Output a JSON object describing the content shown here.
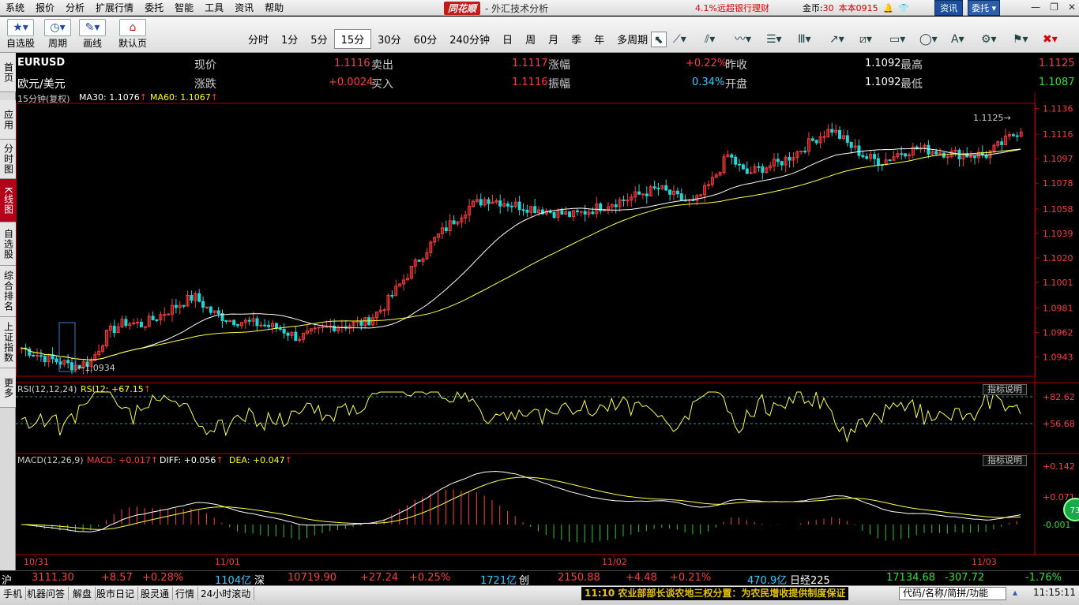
{
  "menu": [
    "系统",
    "报价",
    "分析",
    "扩展行情",
    "委托",
    "智能",
    "工具",
    "资讯",
    "帮助"
  ],
  "brand": {
    "logo": "同花顺",
    "title": "- 外汇技术分析"
  },
  "menu_right": {
    "ad": "4.1%远超银行理财",
    "gold_label": "金币:",
    "gold_value": "30",
    "version": "本本0915",
    "news_btn": "资讯",
    "trade_btn": "委托"
  },
  "toolbar": {
    "buttons": [
      {
        "label": "自选股",
        "icon": "star-icon"
      },
      {
        "label": "周期",
        "icon": "clock-icon"
      },
      {
        "label": "画线",
        "icon": "pencil-icon"
      },
      {
        "label": "默认页",
        "icon": "home-icon"
      }
    ],
    "periods": [
      "分时",
      "1分",
      "5分",
      "15分",
      "30分",
      "60分",
      "240分钟",
      "日",
      "周",
      "月",
      "季",
      "年",
      "多周期"
    ],
    "selected_period": "15分"
  },
  "vtabs": [
    {
      "label": "首页"
    },
    {
      "label": "应用"
    },
    {
      "label": "分时图"
    },
    {
      "label": "K线图",
      "selected": true
    },
    {
      "label": "自选股"
    },
    {
      "label": "综合排名"
    },
    {
      "label": "上证指数"
    },
    {
      "label": "更多"
    }
  ],
  "quote": {
    "symbol": "EURUSD",
    "name": "欧元/美元",
    "labels": {
      "price": "现价",
      "change": "涨跌",
      "sell": "卖出",
      "buy": "买入",
      "pct": "涨幅",
      "amp": "振幅",
      "prev": "昨收",
      "open": "开盘",
      "high": "最高",
      "low": "最低"
    },
    "price": "1.1116",
    "change": "+0.0024",
    "sell": "1.1117",
    "buy": "1.1116",
    "pct": "+0.22%",
    "amp": "0.34%",
    "prev": "1.1092",
    "open": "1.1092",
    "high": "1.1125",
    "low": "1.1087"
  },
  "indicators": {
    "main": {
      "label": "15分钟(复权)",
      "ma30": "MA30: 1.1076",
      "ma60": "MA60: 1.1067"
    },
    "rsi": {
      "label": "RSI(12,12,24)",
      "value": "RSI12: +67.15",
      "button": "指标说明"
    },
    "macd": {
      "label": "MACD(12,26,9)",
      "macd": "MACD: +0.017",
      "diff": "DIFF: +0.056",
      "dea": "DEA: +0.047",
      "button": "指标说明"
    }
  },
  "chart_data": {
    "type": "candlestick",
    "price_axis": {
      "ticks": [
        "1.1136",
        "1.1116",
        "1.1097",
        "1.1078",
        "1.1058",
        "1.1039",
        "1.1020",
        "1.1001",
        "1.0981",
        "1.0962",
        "1.0943"
      ],
      "min": 1.0928,
      "max": 1.114
    },
    "rsi_axis": {
      "ticks": [
        "+82.62",
        "+56.68"
      ]
    },
    "macd_axis": {
      "ticks": [
        "+0.142",
        "+0.071",
        "-0.001"
      ]
    },
    "x_axis": {
      "labels": [
        "10/31",
        "11/01",
        "11/02",
        "11/03"
      ]
    },
    "annotations": {
      "high": "1.1125",
      "low": "1.0934"
    },
    "close_path": [
      1.095,
      1.0944,
      1.094,
      1.0936,
      1.0939,
      1.0962,
      1.097,
      1.0968,
      1.0975,
      1.0983,
      1.099,
      1.0978,
      1.0972,
      1.097,
      1.0968,
      1.0965,
      1.0958,
      1.0962,
      1.0967,
      1.0968,
      1.097,
      1.0982,
      1.1,
      1.1018,
      1.1035,
      1.1048,
      1.106,
      1.1066,
      1.1063,
      1.106,
      1.1058,
      1.1055,
      1.1053,
      1.1057,
      1.1062,
      1.1065,
      1.107,
      1.1074,
      1.1067,
      1.1062,
      1.1078,
      1.11,
      1.1085,
      1.109,
      1.1094,
      1.1102,
      1.1112,
      1.112,
      1.1108,
      1.1098,
      1.1095,
      1.1102,
      1.1105,
      1.1103,
      1.1101,
      1.11,
      1.11,
      1.111,
      1.112
    ]
  },
  "status": {
    "sh": {
      "name": "沪",
      "value": "3111.30",
      "chg": "+8.57",
      "pct": "+0.28%",
      "vol": "1104亿"
    },
    "sz": {
      "name": "深",
      "value": "10719.90",
      "chg": "+27.24",
      "pct": "+0.25%",
      "vol": "1721亿"
    },
    "cy": {
      "name": "创",
      "value": "2150.88",
      "chg": "+4.48",
      "pct": "+0.21%",
      "vol": "470.9亿"
    },
    "nk": {
      "name": "日经225",
      "value": "17134.68",
      "chg": "-307.72",
      "pct": "-1.76%"
    }
  },
  "bottom": {
    "tabs": [
      "手机",
      "机器问答",
      "解盘",
      "股市日记",
      "股灵通",
      "行情",
      "24小时滚动"
    ],
    "news": "11:10 农业部部长谈农地三权分置：为农民增收提供制度保证",
    "search_placeholder": "代码/名称/简拼/功能",
    "clock": "11:15:11"
  },
  "colors": {
    "up": "#ff3b3b",
    "down": "#22d6d6",
    "ma30": "#ffffff",
    "ma60": "#ffff40",
    "macd_up": "#ff3b3b",
    "macd_down": "#22cc22"
  }
}
